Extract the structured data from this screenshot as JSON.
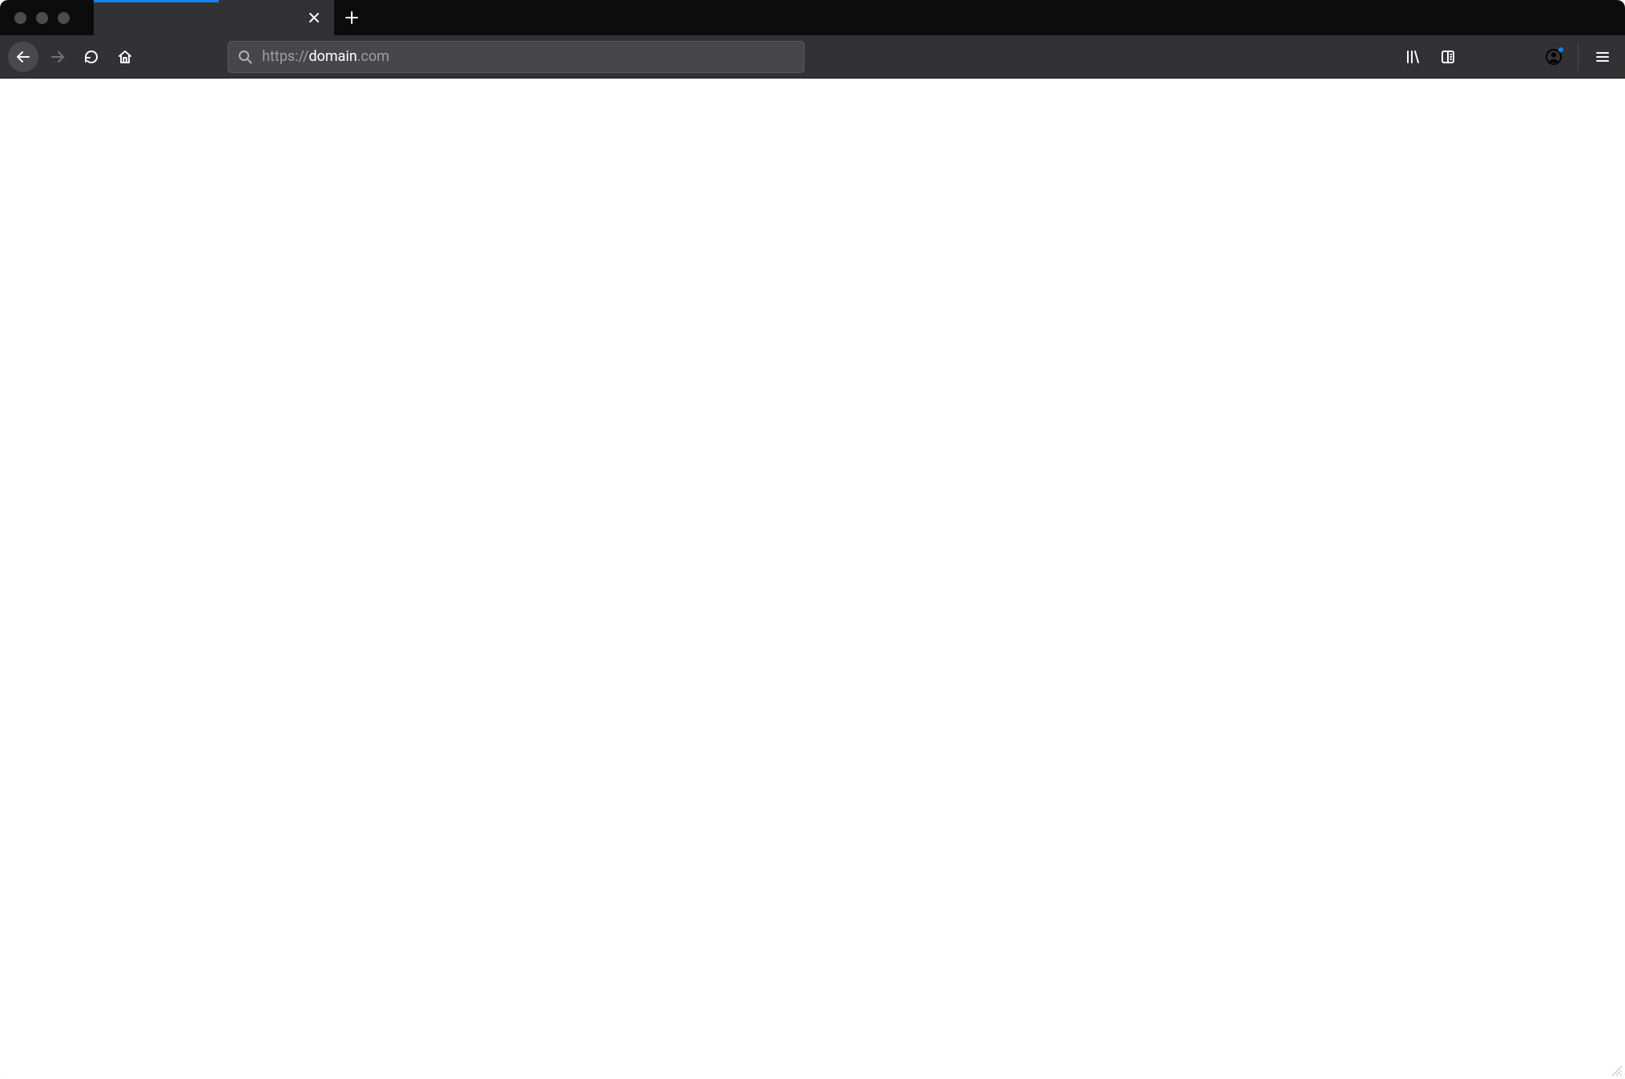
{
  "tabs": {
    "active": {
      "title": ""
    }
  },
  "addressbar": {
    "protocol": "https://",
    "host": "domain",
    "path": ".com"
  },
  "icons": {
    "close": "close-icon",
    "new_tab": "plus-icon",
    "back": "arrow-left-icon",
    "forward": "arrow-right-icon",
    "reload": "reload-icon",
    "home": "home-icon",
    "search": "search-icon",
    "library": "library-icon",
    "sidebar": "sidebar-icon",
    "account": "account-icon",
    "menu": "hamburger-icon"
  },
  "colors": {
    "tabstrip_bg": "#0c0c0d",
    "toolbar_bg": "#323234",
    "urlbar_bg": "#474749",
    "loading_bar": "#0a84ff",
    "icon_fg": "#f9f9fa",
    "icon_disabled": "#737373"
  }
}
